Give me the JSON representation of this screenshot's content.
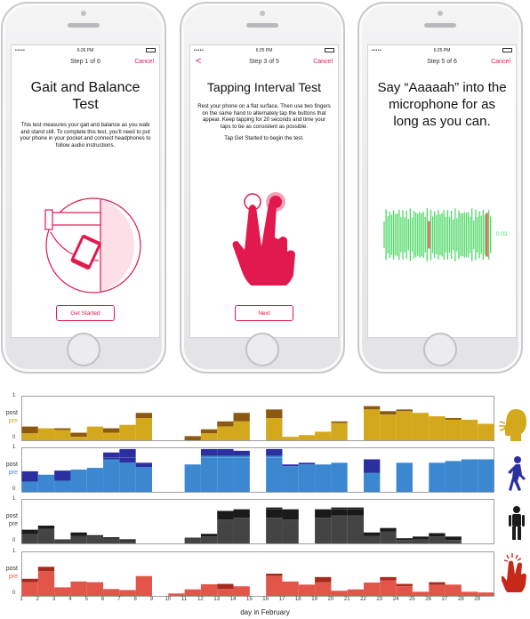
{
  "phones": [
    {
      "time": "6:26 PM",
      "step": "Step 1 of 6",
      "cancel": "Cancel",
      "title": "Gait and Balance Test",
      "body": "This test measures your gait and balance as you walk and stand still. To complete this test, you’ll need to put your phone in your pocket and connect headphones to follow audio instructions.",
      "button": "Get Started"
    },
    {
      "time": "6:25 PM",
      "step": "Step 3 of 5",
      "cancel": "Cancel",
      "back": "<",
      "title": "Tapping Interval Test",
      "body": "Rest your phone on a flat surface. Then use two fingers on the same hand to alternately tap the buttons that appear. Keep tapping for 20 seconds and time your taps to be as consistent as possible.",
      "body2": "Tap Get Started to begin the test.",
      "button": "Next"
    },
    {
      "time": "6:25 PM",
      "step": "Step 5 of 6",
      "cancel": "Cancel",
      "title": "Say “Aaaaah” into the microphone for as long as you can.",
      "timer": "0:03"
    }
  ],
  "colors": {
    "accent": "#e2194f",
    "wave_green": "#4cd964",
    "wave_red": "#e0413a"
  },
  "chart_data": {
    "type": "bar",
    "xlabel": "day in February",
    "days": [
      "1",
      "2",
      "3",
      "4",
      "5",
      "6",
      "7",
      "8",
      "9",
      "10",
      "11",
      "12",
      "13",
      "14",
      "15",
      "16",
      "17",
      "18",
      "19",
      "20",
      "21",
      "22",
      "23",
      "24",
      "25",
      "26",
      "27",
      "28",
      "29"
    ],
    "ylim": [
      0,
      1
    ],
    "yticks": [
      "1",
      "0"
    ],
    "panels": [
      {
        "name": "voice",
        "label_post": "post",
        "label_pre": "pre",
        "pre_color": "#d4a81c",
        "post_color": "#8a5a10",
        "icon": "speaking-head-icon",
        "pre": [
          0.2,
          0.35,
          0.3,
          0.1,
          0.4,
          0.22,
          0.45,
          0.65,
          null,
          null,
          0.0,
          0.2,
          0.4,
          0.55,
          null,
          0.65,
          0.1,
          0.15,
          0.25,
          0.5,
          null,
          0.9,
          0.75,
          0.85,
          0.8,
          0.7,
          0.6,
          0.6,
          0.48
        ],
        "post": [
          0.4,
          0.35,
          0.35,
          0.22,
          0.4,
          0.35,
          0.45,
          0.8,
          null,
          null,
          0.12,
          0.32,
          0.55,
          0.8,
          null,
          0.9,
          0.1,
          0.15,
          0.25,
          0.55,
          null,
          1.0,
          0.85,
          0.9,
          0.8,
          0.7,
          0.65,
          0.6,
          0.48
        ]
      },
      {
        "name": "walking",
        "label_post": "post",
        "label_pre": "pre",
        "pre_color": "#3b87d0",
        "post_color": "#2b2fa0",
        "icon": "walking-person-icon",
        "pre": [
          0.3,
          0.5,
          0.32,
          0.65,
          0.7,
          0.95,
          0.85,
          0.72,
          null,
          null,
          0.8,
          1.05,
          1.05,
          1.05,
          null,
          1.05,
          0.75,
          0.8,
          0.8,
          0.85,
          null,
          0.55,
          null,
          0.85,
          null,
          0.85,
          0.9,
          0.95,
          0.95
        ],
        "post": [
          0.6,
          0.5,
          0.62,
          0.65,
          0.7,
          1.15,
          1.25,
          0.85,
          null,
          null,
          0.8,
          1.25,
          1.25,
          1.2,
          null,
          1.25,
          0.8,
          0.85,
          0.8,
          0.85,
          null,
          0.95,
          null,
          0.85,
          null,
          0.85,
          0.9,
          0.95,
          0.95
        ]
      },
      {
        "name": "standing",
        "label_post": "post",
        "label_pre": "pre",
        "pre_color": "#444444",
        "post_color": "#1a1a1a",
        "icon": "standing-person-icon",
        "pre": [
          0.27,
          0.42,
          0.12,
          0.22,
          0.2,
          0.14,
          0.08,
          null,
          null,
          null,
          0.17,
          0.2,
          0.7,
          0.75,
          null,
          0.75,
          0.7,
          null,
          0.75,
          0.82,
          0.82,
          0.22,
          0.35,
          0.1,
          0.13,
          0.2,
          0.1,
          null,
          null
        ],
        "post": [
          0.4,
          0.52,
          0.12,
          0.32,
          0.24,
          0.18,
          0.12,
          null,
          null,
          null,
          0.17,
          0.28,
          0.95,
          1.0,
          null,
          1.05,
          1.0,
          null,
          1.0,
          1.05,
          1.05,
          0.32,
          0.45,
          0.15,
          0.2,
          0.3,
          0.2,
          null,
          null
        ]
      },
      {
        "name": "tapping",
        "label_post": "post",
        "label_pre": "pre",
        "pre_color": "#e2564a",
        "post_color": "#a62a1e",
        "icon": "tapping-hand-icon",
        "pre": [
          0.4,
          0.72,
          0.25,
          0.42,
          0.4,
          0.2,
          0.17,
          0.58,
          null,
          0.07,
          0.19,
          0.34,
          0.2,
          0.28,
          null,
          0.58,
          0.42,
          0.33,
          0.4,
          0.15,
          0.19,
          0.39,
          0.45,
          0.28,
          0.12,
          0.32,
          0.33,
          0.12,
          0.1
        ],
        "post": [
          0.5,
          0.85,
          0.25,
          0.42,
          0.4,
          0.2,
          0.17,
          0.58,
          null,
          0.07,
          0.19,
          0.34,
          0.35,
          0.28,
          null,
          0.65,
          0.42,
          0.33,
          0.55,
          0.15,
          0.19,
          0.39,
          0.55,
          0.35,
          0.12,
          0.4,
          0.33,
          0.12,
          0.1
        ]
      }
    ]
  }
}
